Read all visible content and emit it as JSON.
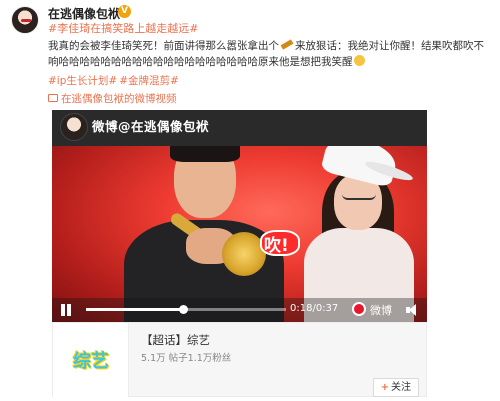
{
  "post": {
    "author": "在逃偶像包袱",
    "vip_badge": "V",
    "topic": "#李佳琦在搞笑路上越走越远#",
    "body_part1": "我真的会被李佳琦笑死！前面讲得那么嚣张拿出个",
    "body_part2": "来放狠话：我绝对让你醒！结果吹都吹不响哈哈哈哈哈哈哈哈哈哈哈哈哈哈哈哈哈哈哈原来他是想把我笑醒",
    "tags": [
      "#ip生长计划#",
      "#金牌混剪#"
    ],
    "video_source": "在逃偶像包袱的微博视频"
  },
  "video": {
    "watermark": "微博@在逃偶像包袱",
    "overlay_text": "吹!",
    "time": "0:18/0:37",
    "platform": "微博",
    "progress_fraction": 0.486,
    "accent": "#e6162d"
  },
  "card": {
    "thumb_text": "综艺",
    "title": "【超话】综艺",
    "stats": "5.1万  帖子1.1万粉丝",
    "follow_label": "关注",
    "follow_plus": "+"
  },
  "colors": {
    "link": "#eb7350",
    "text": "#333333"
  },
  "icons": {
    "vip": "vip-badge-icon",
    "pencil": "pencil-emoji-icon",
    "face": "wink-emoji-icon",
    "video": "video-icon",
    "pause": "pause-icon",
    "volume": "volume-icon",
    "weibo": "weibo-logo-icon"
  }
}
